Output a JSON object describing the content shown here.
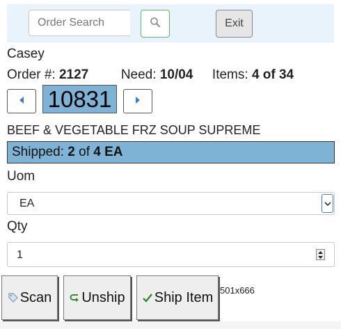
{
  "search": {
    "placeholder": "Order Search",
    "button_icon": "search-icon"
  },
  "toolbar": {
    "exit_label": "Exit"
  },
  "customer": {
    "name": "Casey"
  },
  "order": {
    "number_label": "Order #: ",
    "number": "2127",
    "need_label": "Need: ",
    "need": "10/04",
    "items_label": "Items: ",
    "items": "4 of 34"
  },
  "item": {
    "number": "10831",
    "prev_icon": "caret-left-icon",
    "next_icon": "caret-right-icon",
    "description": "BEEF & VEGETABLE FRZ SOUP SUPREME"
  },
  "shipped": {
    "label": "Shipped: ",
    "count": "2",
    "of": " of ",
    "total": "4 EA"
  },
  "uom": {
    "label": "Uom",
    "value": "EA"
  },
  "qty": {
    "label": "Qty",
    "value": "1"
  },
  "actions": {
    "scan_label": "Scan",
    "scan_icon": "tag-icon",
    "unship_label": "Unship",
    "unship_icon": "return-arrow-icon",
    "ship_label": "Ship Item",
    "ship_icon": "checkmark-icon"
  },
  "viewport_note": "501x666",
  "colors": {
    "accent_blue": "#7fb3d5",
    "topbar_bg": "#e9f3fc",
    "search_button_border": "#5cb85c",
    "nav_arrow": "#3a7bd5"
  }
}
